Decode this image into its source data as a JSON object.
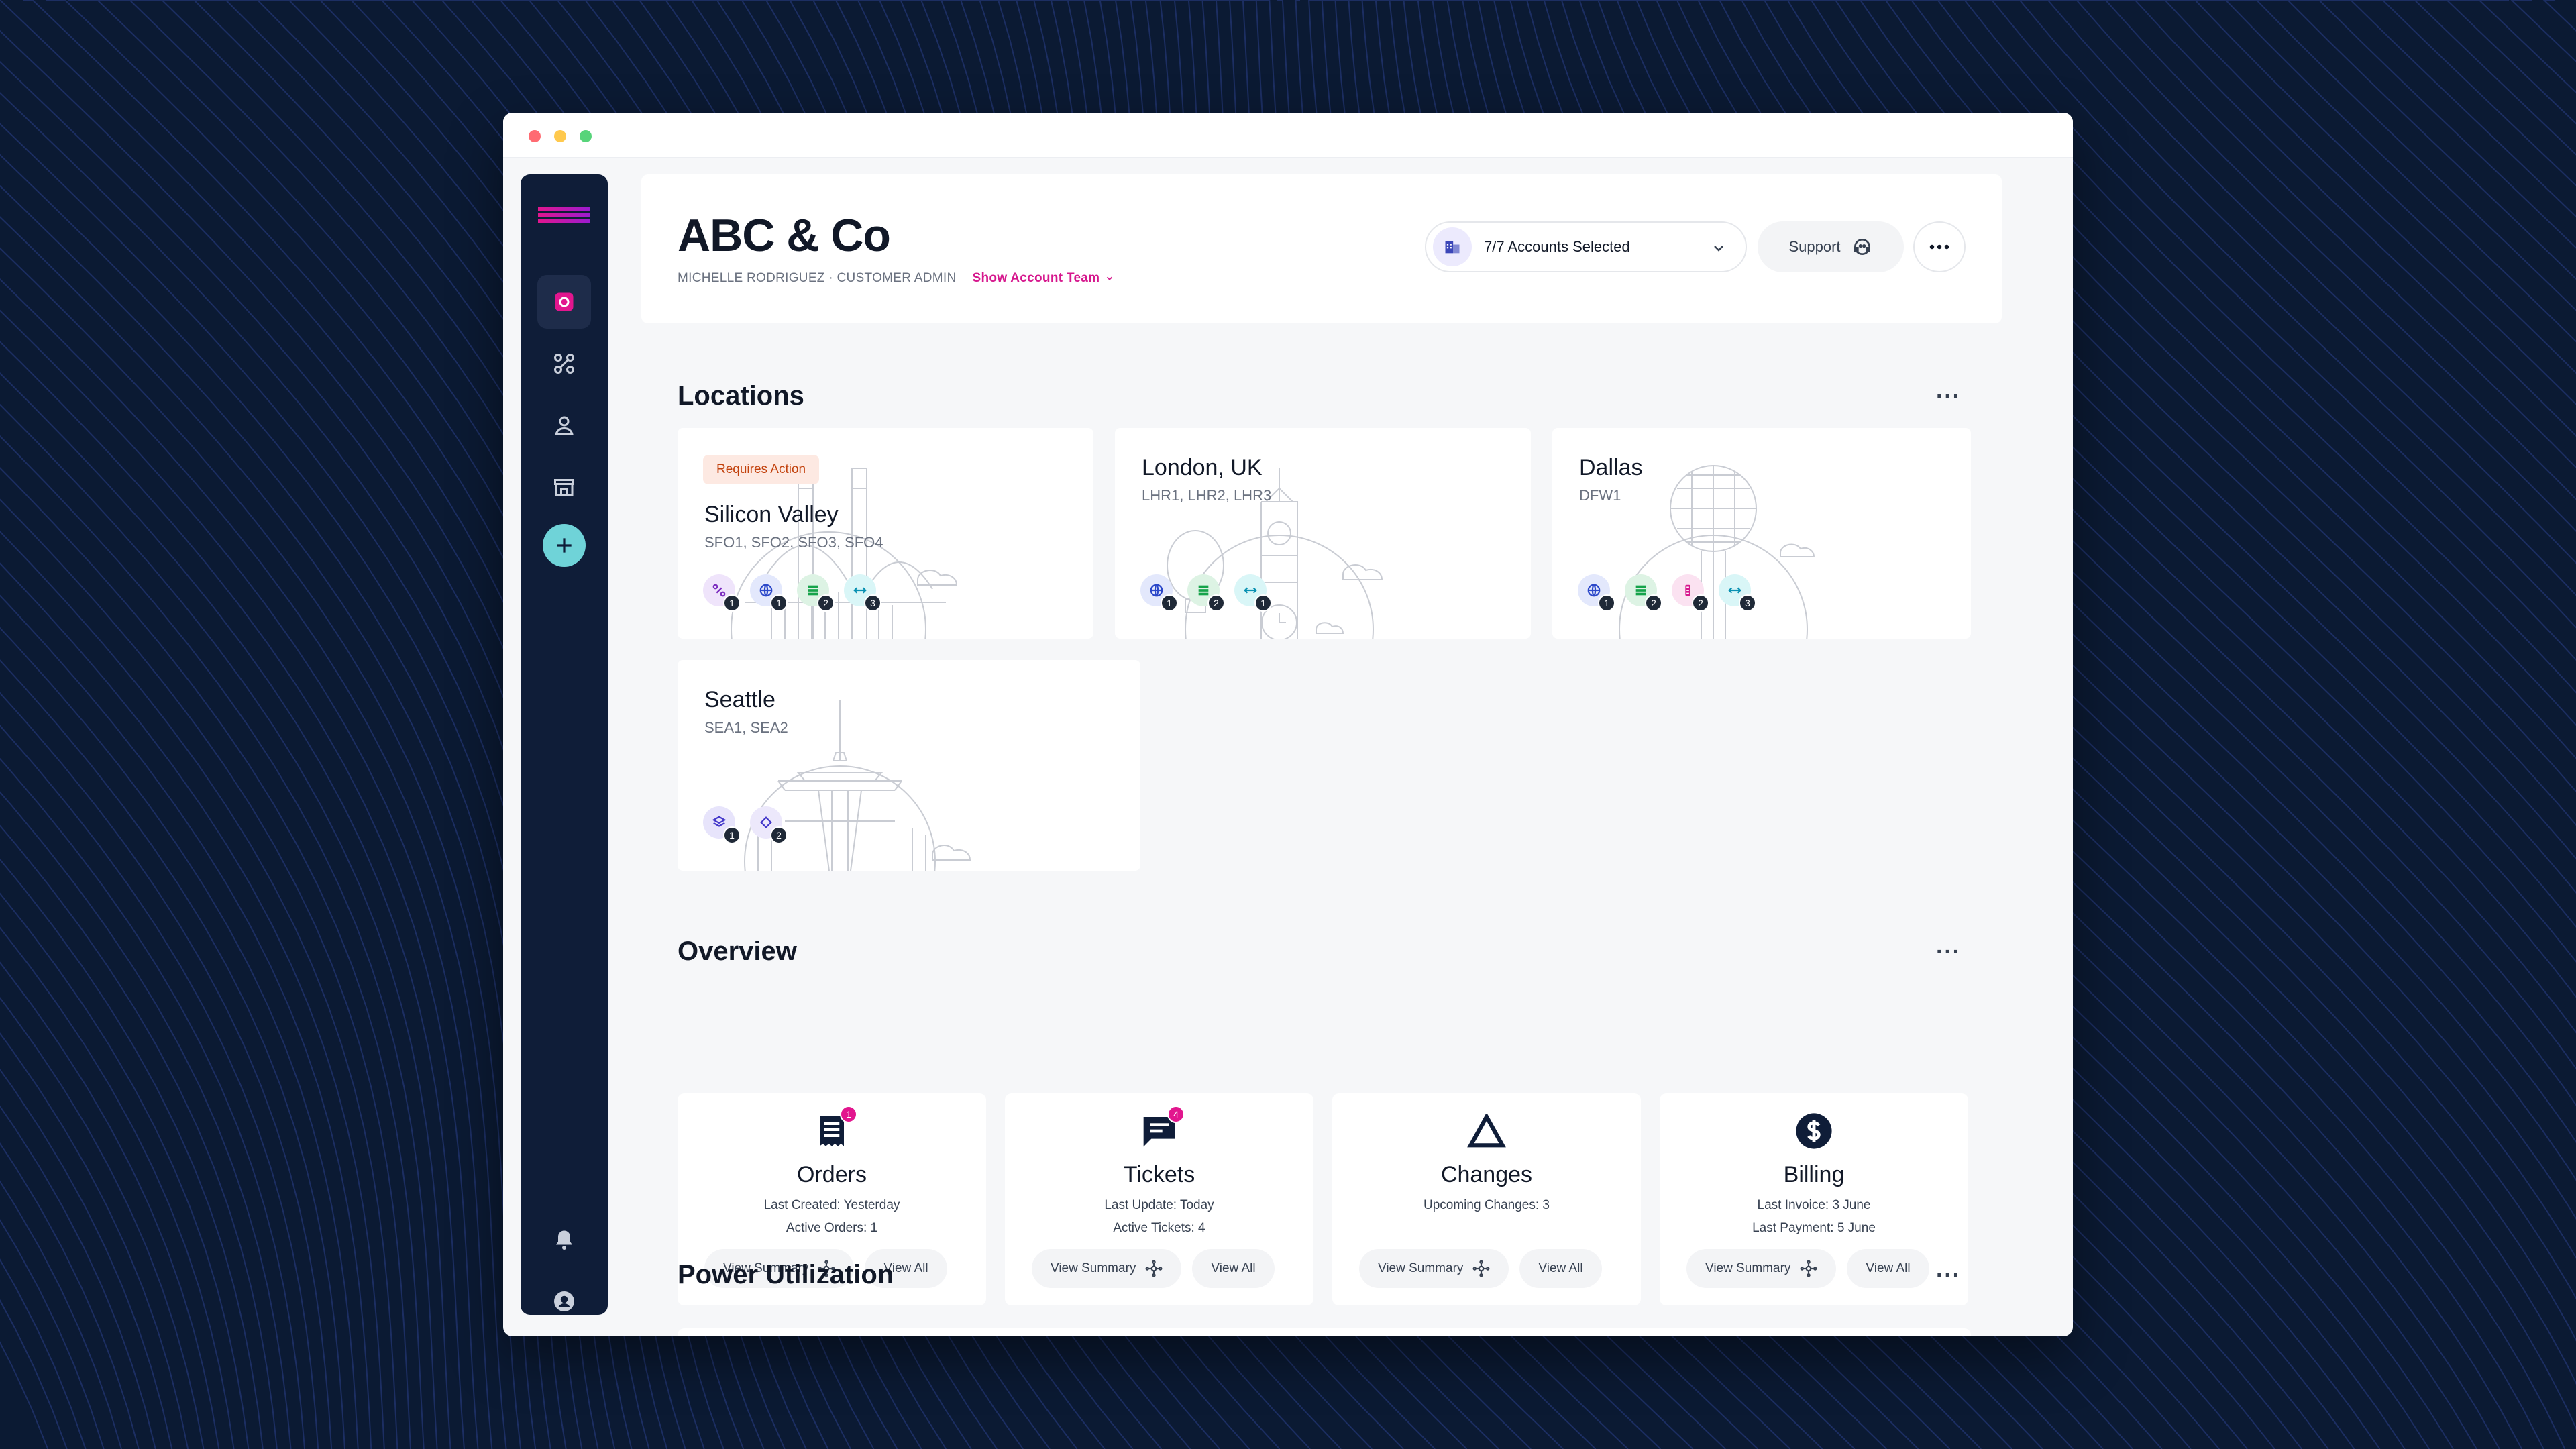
{
  "header": {
    "company": "ABC & Co",
    "user_line": "MICHELLE RODRIGUEZ · CUSTOMER ADMIN",
    "show_team": "Show Account Team",
    "accounts_selected": "7/7 Accounts Selected",
    "support": "Support"
  },
  "sections": {
    "locations": "Locations",
    "overview": "Overview",
    "power": "Power Utilization"
  },
  "locations": [
    {
      "name": "Silicon Valley",
      "codes": "SFO1, SFO2, SFO3, SFO4",
      "badge": "Requires Action",
      "chips": [
        "1",
        "1",
        "2",
        "3"
      ]
    },
    {
      "name": "London, UK",
      "codes": "LHR1, LHR2, LHR3",
      "chips": [
        "1",
        "2",
        "1"
      ]
    },
    {
      "name": "Dallas",
      "codes": "DFW1",
      "chips": [
        "1",
        "2",
        "2",
        "3"
      ]
    },
    {
      "name": "Seattle",
      "codes": "SEA1, SEA2",
      "chips": [
        "1",
        "2"
      ]
    }
  ],
  "overview": [
    {
      "title": "Orders",
      "line1": "Last Created: Yesterday",
      "line2": "Active Orders: 1",
      "notif": "1"
    },
    {
      "title": "Tickets",
      "line1": "Last Update: Today",
      "line2": "Active Tickets: 4",
      "notif": "4"
    },
    {
      "title": "Changes",
      "line1": "Upcoming Changes: 3",
      "line2": ""
    },
    {
      "title": "Billing",
      "line1": "Last Invoice: 3 June",
      "line2": "Last Payment: 5 June"
    }
  ],
  "buttons": {
    "view_summary": "View Summary",
    "view_all": "View All"
  },
  "colors": {
    "accent": "#e2168e",
    "sidebar": "#0f1d38",
    "add_button": "#6fd3d8",
    "background": "#0b1a33"
  }
}
